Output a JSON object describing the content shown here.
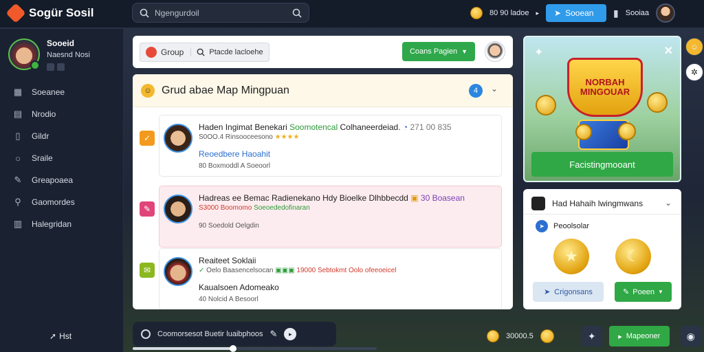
{
  "app": {
    "title": "Sogür Sosil"
  },
  "search": {
    "placeholder": "Ngengurdoil"
  },
  "topbar": {
    "coins_text": "80 90 ladoe",
    "action_label": "Sooean",
    "user_text": "Sooiaa"
  },
  "profile": {
    "name": "Sooeid",
    "subtitle": "Naesnd Nosi"
  },
  "sidebar": {
    "items": [
      {
        "label": "Soeanee",
        "icon": "grid-icon"
      },
      {
        "label": "Nrodio",
        "icon": "calendar-icon"
      },
      {
        "label": "Gildr",
        "icon": "file-icon"
      },
      {
        "label": "Sraile",
        "icon": "search-icon"
      },
      {
        "label": "Greapoaea",
        "icon": "pencil-icon"
      },
      {
        "label": "Gaomordes",
        "icon": "magnifier-icon"
      },
      {
        "label": "Halegridan",
        "icon": "table-icon"
      }
    ],
    "footer_label": "Hst"
  },
  "group_bar": {
    "group_label": "Group",
    "search_label": "Ptacde lacloehe",
    "action_label": "Coans Pagien"
  },
  "feed": {
    "title": "Grud abae Map Mingpuan",
    "badge": "4",
    "posts": [
      {
        "name": "Haden Ingimat Benekari",
        "name_extra": "Soomotencal",
        "name_extra2": "Colhaneerdeiad.",
        "time": "271 00 835",
        "meta": "S0OO.4 Rinsooceesono",
        "body": "Reoedbere Haoahit",
        "foot": "80 Boxmoddl A Soeoorl",
        "tag_color": "#f39a1e"
      },
      {
        "name": "Hadreas ee Bemac Radienekano Hdy Bioelke Dlhbbecdd",
        "name_extra": "30 Boasean",
        "meta": "S3000 Boomomo",
        "meta_extra": "Soeoededofinaran",
        "foot": "90 Soedold Oelgdin",
        "tag_color": "#e0457a"
      },
      {
        "name": "Reaiteet Soklaii",
        "meta": "Oelo Baasencelsocan",
        "meta_extra": "19000 Sebtokmt Oolo ofeeoeicel",
        "body": "Kaualsoen Adomeako",
        "foot": "40 Nolcid A Besoorl",
        "tag_color": "#8ab81e"
      }
    ]
  },
  "promo": {
    "banner_text": "NORBAH MINGOUAR",
    "button_label": "Facistingmooant"
  },
  "reward": {
    "title": "Had Hahaih lwingmwans",
    "sub_label": "Peoolsolar",
    "button1_label": "Crigonsans",
    "button2_label": "Poeen"
  },
  "bottom": {
    "status_text": "Coomorsesot Buetir luaibphoos",
    "progress": 0.41,
    "coins_text": "30000.5",
    "button_label": "Mapeoner"
  },
  "colors": {
    "accent_blue": "#2f9bea",
    "accent_green": "#2fa845",
    "brand_orange": "#f0592a"
  }
}
